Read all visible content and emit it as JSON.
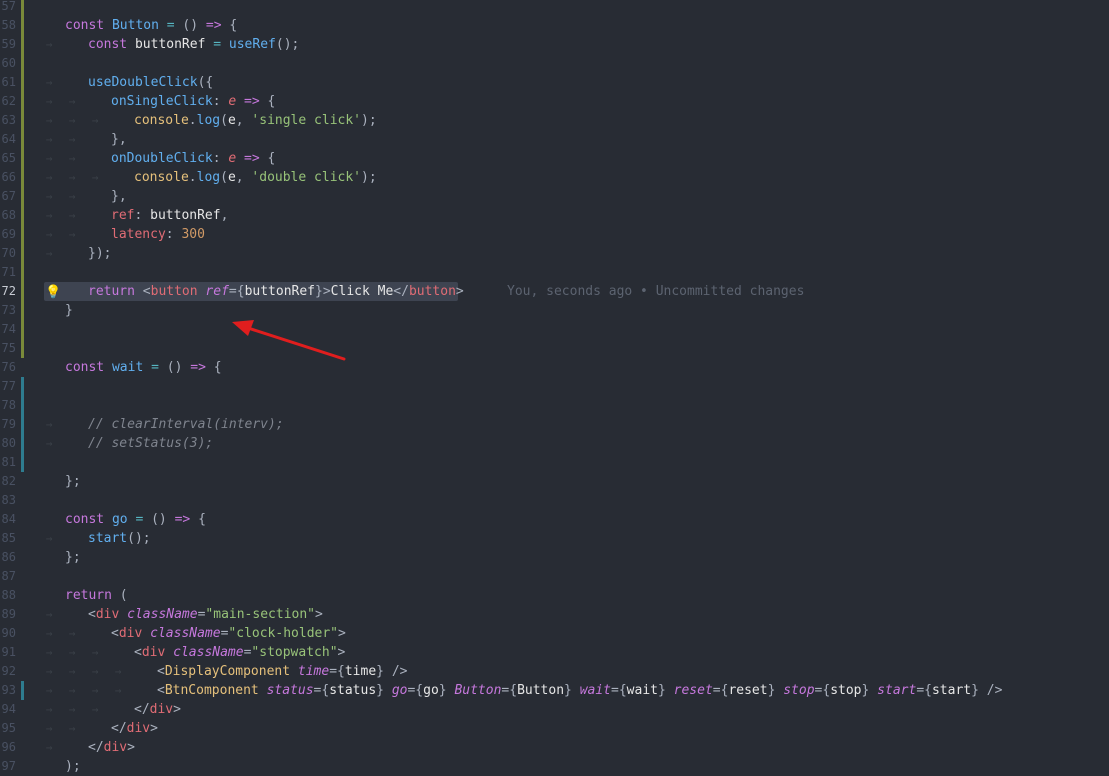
{
  "blame": "You, seconds ago • Uncommitted changes",
  "lines": [
    {
      "n": "57",
      "git": "added",
      "indent": 0,
      "tokens": []
    },
    {
      "n": "58",
      "git": "added",
      "indent": 0,
      "tokens": [
        [
          "kw",
          "const "
        ],
        [
          "fn",
          "Button"
        ],
        [
          "op",
          " = "
        ],
        [
          "punc",
          "() "
        ],
        [
          "kw",
          "=>"
        ],
        [
          "punc",
          " {"
        ]
      ]
    },
    {
      "n": "59",
      "git": "added",
      "indent": 1,
      "tokens": [
        [
          "kw",
          "const "
        ],
        [
          "plain",
          "buttonRef"
        ],
        [
          "op",
          " = "
        ],
        [
          "fn",
          "useRef"
        ],
        [
          "punc",
          "();"
        ]
      ]
    },
    {
      "n": "60",
      "git": "added",
      "indent": 0,
      "tokens": []
    },
    {
      "n": "61",
      "git": "added",
      "indent": 1,
      "tokens": [
        [
          "fn",
          "useDoubleClick"
        ],
        [
          "punc",
          "({"
        ]
      ]
    },
    {
      "n": "62",
      "git": "added",
      "indent": 2,
      "tokens": [
        [
          "prop",
          "onSingleClick"
        ],
        [
          "punc",
          ": "
        ],
        [
          "param",
          "e"
        ],
        [
          "kw",
          " =>"
        ],
        [
          "punc",
          " {"
        ]
      ]
    },
    {
      "n": "63",
      "git": "added",
      "indent": 3,
      "tokens": [
        [
          "var",
          "console"
        ],
        [
          "punc",
          "."
        ],
        [
          "fn",
          "log"
        ],
        [
          "punc",
          "("
        ],
        [
          "plain",
          "e"
        ],
        [
          "punc",
          ", "
        ],
        [
          "str",
          "'single click'"
        ],
        [
          "punc",
          ");"
        ]
      ]
    },
    {
      "n": "64",
      "git": "added",
      "indent": 2,
      "tokens": [
        [
          "punc",
          "},"
        ]
      ]
    },
    {
      "n": "65",
      "git": "added",
      "indent": 2,
      "tokens": [
        [
          "prop",
          "onDoubleClick"
        ],
        [
          "punc",
          ": "
        ],
        [
          "param",
          "e"
        ],
        [
          "kw",
          " =>"
        ],
        [
          "punc",
          " {"
        ]
      ]
    },
    {
      "n": "66",
      "git": "added",
      "indent": 3,
      "tokens": [
        [
          "var",
          "console"
        ],
        [
          "punc",
          "."
        ],
        [
          "fn",
          "log"
        ],
        [
          "punc",
          "("
        ],
        [
          "plain",
          "e"
        ],
        [
          "punc",
          ", "
        ],
        [
          "str",
          "'double click'"
        ],
        [
          "punc",
          ");"
        ]
      ]
    },
    {
      "n": "67",
      "git": "added",
      "indent": 2,
      "tokens": [
        [
          "punc",
          "},"
        ]
      ]
    },
    {
      "n": "68",
      "git": "added",
      "indent": 2,
      "tokens": [
        [
          "tag",
          "ref"
        ],
        [
          "punc",
          ": "
        ],
        [
          "plain",
          "buttonRef"
        ],
        [
          "punc",
          ","
        ]
      ]
    },
    {
      "n": "69",
      "git": "added",
      "indent": 2,
      "tokens": [
        [
          "tag",
          "latency"
        ],
        [
          "punc",
          ": "
        ],
        [
          "num",
          "300"
        ]
      ]
    },
    {
      "n": "70",
      "git": "added",
      "indent": 1,
      "tokens": [
        [
          "punc",
          "});"
        ]
      ]
    },
    {
      "n": "71",
      "git": "added",
      "indent": 0,
      "tokens": []
    },
    {
      "n": "72",
      "git": "added",
      "indent": 1,
      "current": true,
      "bulb": true,
      "tokens": [
        [
          "kw",
          "return "
        ],
        [
          "punc",
          "<"
        ],
        [
          "tag",
          "button"
        ],
        [
          "punc",
          " "
        ],
        [
          "attr",
          "ref"
        ],
        [
          "punc",
          "={"
        ],
        [
          "plain",
          "buttonRef"
        ],
        [
          "punc",
          "}>"
        ],
        [
          "plain",
          "Click Me"
        ],
        [
          "punc",
          "</"
        ],
        [
          "tag",
          "button"
        ],
        [
          "punc",
          ">"
        ]
      ]
    },
    {
      "n": "73",
      "git": "added",
      "indent": 0,
      "tokens": [
        [
          "punc",
          "}"
        ]
      ]
    },
    {
      "n": "74",
      "git": "added",
      "indent": 0,
      "tokens": []
    },
    {
      "n": "75",
      "git": "added",
      "indent": 0,
      "tokens": []
    },
    {
      "n": "76",
      "git": "none",
      "indent": 0,
      "tokens": [
        [
          "kw",
          "const "
        ],
        [
          "fn",
          "wait"
        ],
        [
          "op",
          " = "
        ],
        [
          "punc",
          "() "
        ],
        [
          "kw",
          "=>"
        ],
        [
          "punc",
          " {"
        ]
      ]
    },
    {
      "n": "77",
      "git": "mod",
      "indent": 0,
      "tokens": []
    },
    {
      "n": "78",
      "git": "mod",
      "indent": 0,
      "tokens": []
    },
    {
      "n": "79",
      "git": "mod",
      "indent": 1,
      "tokens": [
        [
          "comment",
          "// clearInterval(interv);"
        ]
      ]
    },
    {
      "n": "80",
      "git": "mod",
      "indent": 1,
      "tokens": [
        [
          "comment",
          "// setStatus(3);"
        ]
      ]
    },
    {
      "n": "81",
      "git": "mod",
      "indent": 0,
      "tokens": []
    },
    {
      "n": "82",
      "git": "none",
      "indent": 0,
      "tokens": [
        [
          "punc",
          "};"
        ]
      ]
    },
    {
      "n": "83",
      "git": "none",
      "indent": 0,
      "tokens": []
    },
    {
      "n": "84",
      "git": "none",
      "indent": 0,
      "tokens": [
        [
          "kw",
          "const "
        ],
        [
          "fn",
          "go"
        ],
        [
          "op",
          " = "
        ],
        [
          "punc",
          "() "
        ],
        [
          "kw",
          "=>"
        ],
        [
          "punc",
          " {"
        ]
      ]
    },
    {
      "n": "85",
      "git": "none",
      "indent": 1,
      "tokens": [
        [
          "fn",
          "start"
        ],
        [
          "punc",
          "();"
        ]
      ]
    },
    {
      "n": "86",
      "git": "none",
      "indent": 0,
      "tokens": [
        [
          "punc",
          "};"
        ]
      ]
    },
    {
      "n": "87",
      "git": "none",
      "indent": 0,
      "tokens": []
    },
    {
      "n": "88",
      "git": "none",
      "indent": 0,
      "tokens": [
        [
          "kw",
          "return "
        ],
        [
          "punc",
          "("
        ]
      ]
    },
    {
      "n": "89",
      "git": "none",
      "indent": 1,
      "tokens": [
        [
          "punc",
          "<"
        ],
        [
          "tag",
          "div"
        ],
        [
          "punc",
          " "
        ],
        [
          "attr",
          "className"
        ],
        [
          "punc",
          "="
        ],
        [
          "str",
          "\"main-section\""
        ],
        [
          "punc",
          ">"
        ]
      ]
    },
    {
      "n": "90",
      "git": "none",
      "indent": 2,
      "tokens": [
        [
          "punc",
          "<"
        ],
        [
          "tag",
          "div"
        ],
        [
          "punc",
          " "
        ],
        [
          "attr",
          "className"
        ],
        [
          "punc",
          "="
        ],
        [
          "str",
          "\"clock-holder\""
        ],
        [
          "punc",
          ">"
        ]
      ]
    },
    {
      "n": "91",
      "git": "none",
      "indent": 3,
      "tokens": [
        [
          "punc",
          "<"
        ],
        [
          "tag",
          "div"
        ],
        [
          "punc",
          " "
        ],
        [
          "attr",
          "className"
        ],
        [
          "punc",
          "="
        ],
        [
          "str",
          "\"stopwatch\""
        ],
        [
          "punc",
          ">"
        ]
      ]
    },
    {
      "n": "92",
      "git": "none",
      "indent": 4,
      "tokens": [
        [
          "punc",
          "<"
        ],
        [
          "var",
          "DisplayComponent"
        ],
        [
          "punc",
          " "
        ],
        [
          "attr",
          "time"
        ],
        [
          "punc",
          "={"
        ],
        [
          "plain",
          "time"
        ],
        [
          "punc",
          "} />"
        ]
      ]
    },
    {
      "n": "93",
      "git": "mod",
      "indent": 4,
      "tokens": [
        [
          "punc",
          "<"
        ],
        [
          "var",
          "BtnComponent"
        ],
        [
          "punc",
          " "
        ],
        [
          "attr",
          "status"
        ],
        [
          "punc",
          "={"
        ],
        [
          "plain",
          "status"
        ],
        [
          "punc",
          "} "
        ],
        [
          "attr",
          "go"
        ],
        [
          "punc",
          "={"
        ],
        [
          "plain",
          "go"
        ],
        [
          "punc",
          "} "
        ],
        [
          "attr",
          "Button"
        ],
        [
          "punc",
          "={"
        ],
        [
          "plain",
          "Button"
        ],
        [
          "punc",
          "} "
        ],
        [
          "attr",
          "wait"
        ],
        [
          "punc",
          "={"
        ],
        [
          "plain",
          "wait"
        ],
        [
          "punc",
          "} "
        ],
        [
          "attr",
          "reset"
        ],
        [
          "punc",
          "={"
        ],
        [
          "plain",
          "reset"
        ],
        [
          "punc",
          "} "
        ],
        [
          "attr",
          "stop"
        ],
        [
          "punc",
          "={"
        ],
        [
          "plain",
          "stop"
        ],
        [
          "punc",
          "} "
        ],
        [
          "attr",
          "start"
        ],
        [
          "punc",
          "={"
        ],
        [
          "plain",
          "start"
        ],
        [
          "punc",
          "} />"
        ]
      ]
    },
    {
      "n": "94",
      "git": "none",
      "indent": 3,
      "tokens": [
        [
          "punc",
          "</"
        ],
        [
          "tag",
          "div"
        ],
        [
          "punc",
          ">"
        ]
      ]
    },
    {
      "n": "95",
      "git": "none",
      "indent": 2,
      "tokens": [
        [
          "punc",
          "</"
        ],
        [
          "tag",
          "div"
        ],
        [
          "punc",
          ">"
        ]
      ]
    },
    {
      "n": "96",
      "git": "none",
      "indent": 1,
      "tokens": [
        [
          "punc",
          "</"
        ],
        [
          "tag",
          "div"
        ],
        [
          "punc",
          ">"
        ]
      ]
    },
    {
      "n": "97",
      "git": "none",
      "indent": 0,
      "tokens": [
        [
          "punc",
          ");"
        ]
      ]
    }
  ]
}
